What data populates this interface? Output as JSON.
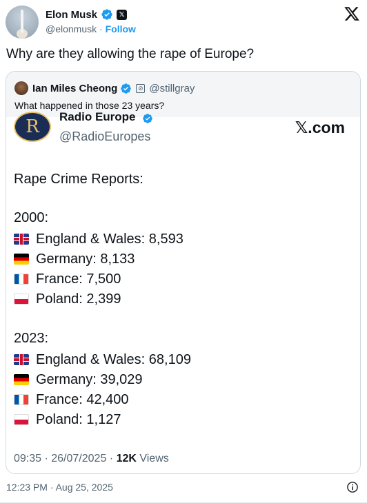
{
  "post": {
    "author_name": "Elon Musk",
    "author_handle": "@elonmusk",
    "follow_label": "Follow",
    "separator": "·",
    "text": "Why are they allowing the rape of Europe?",
    "timestamp": "12:23 PM · Aug 25, 2025"
  },
  "quote": {
    "author_name": "Ian Miles Cheong",
    "author_handle": "@stillgray",
    "text": "What happened in those 23 years?",
    "image": {
      "logo_letter": "R",
      "name": "Radio Europe",
      "handle": "@RadioEuropes",
      "brand": "𝕏.com",
      "title": "Rape Crime Reports:",
      "groups": [
        {
          "year": "2000:",
          "rows": [
            {
              "flag": "uk-flag",
              "label": "England & Wales: 8,593"
            },
            {
              "flag": "germany-flag",
              "label": "Germany: 8,133"
            },
            {
              "flag": "france-flag",
              "label": "France: 7,500"
            },
            {
              "flag": "poland-flag",
              "label": "Poland: 2,399"
            }
          ]
        },
        {
          "year": "2023:",
          "rows": [
            {
              "flag": "uk-flag",
              "label": "England & Wales: 68,109"
            },
            {
              "flag": "germany-flag",
              "label": "Germany: 39,029"
            },
            {
              "flag": "france-flag",
              "label": "France: 42,400"
            },
            {
              "flag": "poland-flag",
              "label": "Poland: 1,127"
            }
          ]
        }
      ],
      "meta_time": "09:35 · 26/07/2025 · ",
      "meta_views_count": "12K",
      "meta_views_label": " Views"
    }
  },
  "icons": {
    "verified": "verified-badge-icon",
    "x_logo": "x-logo-icon",
    "info": "info-icon"
  },
  "colors": {
    "accent": "#1d9bf0",
    "muted": "#536471",
    "text": "#0f1419",
    "border": "#cfd9de"
  }
}
